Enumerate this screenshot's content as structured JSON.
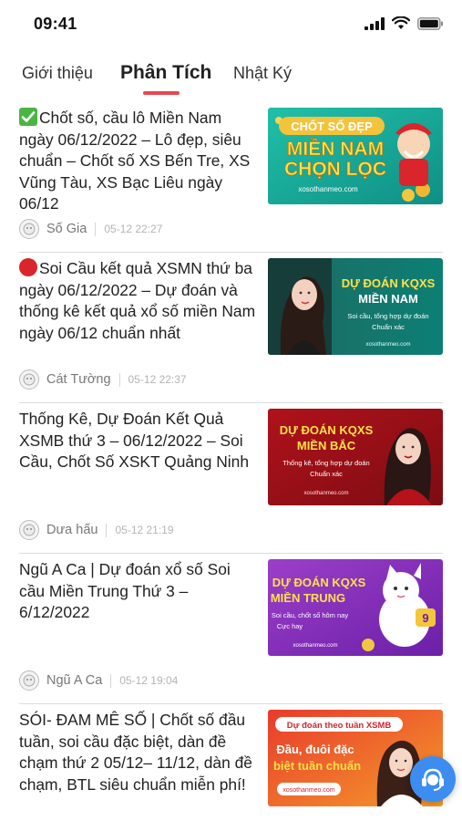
{
  "status_bar": {
    "time": "09:41"
  },
  "tabs": [
    {
      "label": "Giới thiệu"
    },
    {
      "label": "Phân Tích"
    },
    {
      "label": "Nhật Ký"
    }
  ],
  "articles": [
    {
      "title": "Chốt số, cầu lô Miền Nam ngày 06/12/2022 – Lô đẹp, siêu chuẩn – Chốt số XS Bến Tre, XS Vũng Tàu, XS Bạc Liêu ngày 06/12",
      "author": "Số Gia",
      "time": "05-12 22:27",
      "icon": "check-mark-icon",
      "thumb": {
        "line1": "CHỐT SỐ ĐẸP",
        "line2": "MIỀN NAM",
        "line3": "CHỌN LỌC",
        "site": "xosothanmeo.com"
      }
    },
    {
      "title": "Soi Cầu kết quả XSMN thứ ba ngày 06/12/2022 – Dự đoán và thống kê kết quả xổ số miền Nam ngày 06/12 chuẩn nhất",
      "author": "Cát Tường",
      "time": "05-12 22:37",
      "icon": "red-circle-icon",
      "thumb": {
        "line1": "DỰ ĐOÁN KQXS",
        "line2": "MIỀN NAM",
        "line3": "Soi cầu, tổng hợp dự đoán",
        "line4": "Chuẩn xác",
        "site": "xosothanmeo.com"
      }
    },
    {
      "title": "Thống Kê, Dự Đoán Kết Quả XSMB thứ 3 – 06/12/2022 – Soi Cầu, Chốt Số XSKT Quảng Ninh",
      "author": "Dưa hấu",
      "time": "05-12 21:19",
      "thumb": {
        "line1": "DỰ ĐOÁN KQXS",
        "line2": "MIỀN BẮC",
        "line3": "Thống kê, tổng hợp dự đoán",
        "line4": "Chuẩn xác",
        "site": "xosothanmeo.com"
      }
    },
    {
      "title": "Ngũ A Ca | Dự đoán xổ số Soi cầu Miền Trung Thứ 3 – 6/12/2022",
      "author": "Ngũ A Ca",
      "time": "05-12 19:04",
      "thumb": {
        "line1": "DỰ ĐOÁN KQXS",
        "line2": "MIỀN TRUNG",
        "line3": "Soi cầu, chốt số hôm nay",
        "line4": "Cực hay",
        "site": "xosothanmeo.com"
      }
    },
    {
      "title": "SÓI- ĐAM MÊ SỐ | Chốt số đầu tuần, soi cầu đặc biệt, dàn đề chạm thứ 2 05/12– 11/12, dàn đề chạm, BTL siêu chuẩn miễn phí!",
      "author": "",
      "time": "",
      "thumb": {
        "line1": "Dự đoán theo tuần XSMB",
        "line2": "Đầu, đuôi đặc",
        "line3": "biệt tuần chuẩn",
        "site": "xosothanmeo.com"
      }
    }
  ],
  "floating_button": {
    "icon": "support-agent-icon"
  },
  "colors": {
    "accent": "#e8474f",
    "meta_text": "#777777",
    "timestamp_text": "#b4b4b4",
    "float_button": "#3d8df0"
  }
}
